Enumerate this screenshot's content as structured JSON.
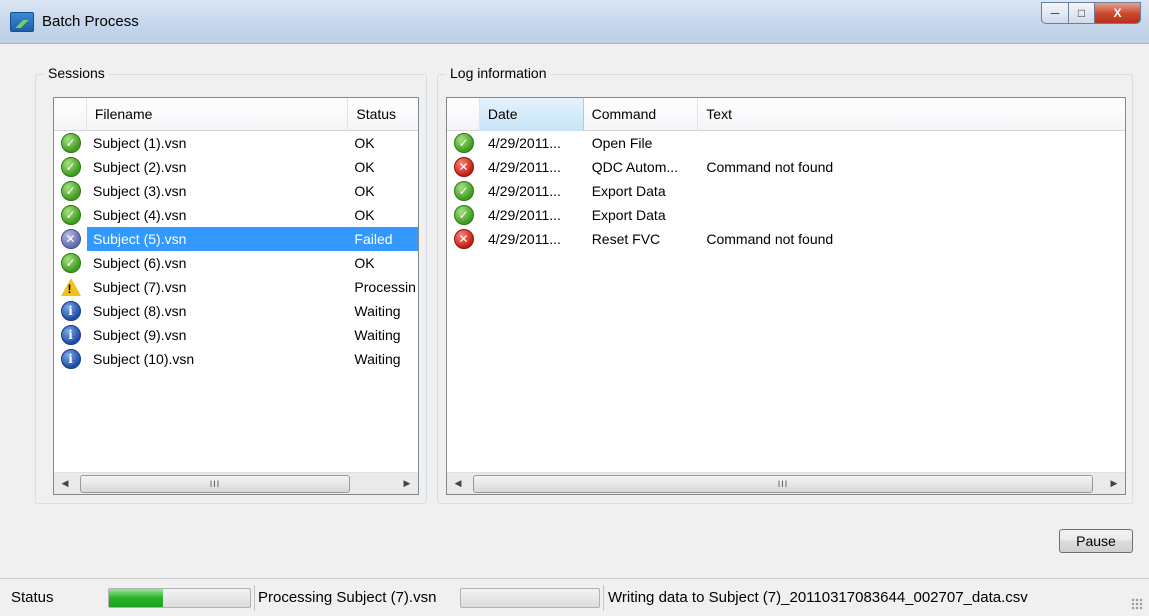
{
  "window": {
    "title": "Batch Process",
    "controls": {
      "minimize": "─",
      "maximize": "□",
      "close": "X"
    }
  },
  "sessions": {
    "group_label": "Sessions",
    "columns": [
      "Filename",
      "Status"
    ],
    "rows": [
      {
        "icon": "ok-icon",
        "filename": "Subject (1).vsn",
        "status": "OK"
      },
      {
        "icon": "ok-icon",
        "filename": "Subject (2).vsn",
        "status": "OK"
      },
      {
        "icon": "ok-icon",
        "filename": "Subject (3).vsn",
        "status": "OK"
      },
      {
        "icon": "ok-icon",
        "filename": "Subject (4).vsn",
        "status": "OK"
      },
      {
        "icon": "failed-icon",
        "filename": "Subject (5).vsn",
        "status": "Failed",
        "selected": true
      },
      {
        "icon": "ok-icon",
        "filename": "Subject (6).vsn",
        "status": "OK"
      },
      {
        "icon": "warning-icon",
        "filename": "Subject (7).vsn",
        "status": "Processin"
      },
      {
        "icon": "info-icon",
        "filename": "Subject (8).vsn",
        "status": "Waiting"
      },
      {
        "icon": "info-icon",
        "filename": "Subject (9).vsn",
        "status": "Waiting"
      },
      {
        "icon": "info-icon",
        "filename": "Subject (10).vsn",
        "status": "Waiting"
      }
    ],
    "scroll_thumb": "III"
  },
  "log": {
    "group_label": "Log information",
    "columns": [
      "Date",
      "Command",
      "Text"
    ],
    "rows": [
      {
        "icon": "ok-icon",
        "date": "4/29/2011...",
        "command": "Open File",
        "text": ""
      },
      {
        "icon": "error-icon",
        "date": "4/29/2011...",
        "command": "QDC Autom...",
        "text": "Command not found"
      },
      {
        "icon": "ok-icon",
        "date": "4/29/2011...",
        "command": "Export Data",
        "text": ""
      },
      {
        "icon": "ok-icon",
        "date": "4/29/2011...",
        "command": "Export Data",
        "text": ""
      },
      {
        "icon": "error-icon",
        "date": "4/29/2011...",
        "command": "Reset FVC",
        "text": "Command not found"
      }
    ],
    "scroll_thumb": "III"
  },
  "actions": {
    "pause_label": "Pause"
  },
  "statusbar": {
    "label": "Status",
    "overall_progress": 0.38,
    "processing_text": "Processing Subject (7).vsn",
    "file_progress": 0.0,
    "writing_text": "Writing data to Subject (7)_20110317083644_002707_data.csv"
  },
  "colors": {
    "selection": "#3399ff",
    "progress_fill": "#26b326",
    "ok": "#3f9a1f",
    "error": "#c41f12",
    "info": "#1f4ea8",
    "warning": "#f2c21b"
  }
}
